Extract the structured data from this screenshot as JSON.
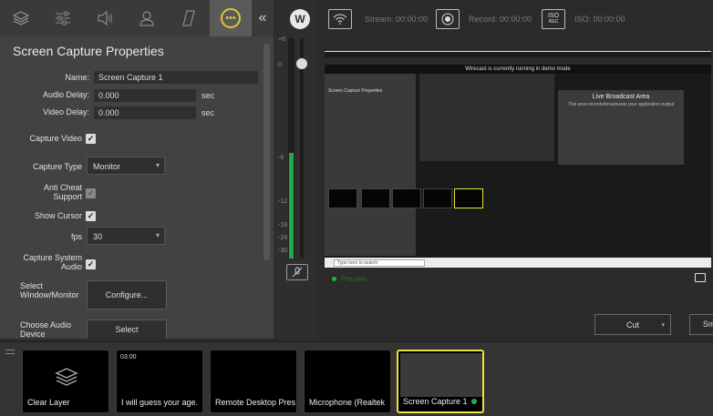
{
  "left_tabs": [
    {
      "name": "layers",
      "icon": "layers-icon"
    },
    {
      "name": "properties",
      "icon": "sliders-icon"
    },
    {
      "name": "audio",
      "icon": "speaker-icon"
    },
    {
      "name": "user",
      "icon": "user-icon"
    },
    {
      "name": "edit",
      "icon": "slash-icon"
    },
    {
      "name": "more",
      "icon": "ellipsis-icon",
      "active": true
    }
  ],
  "collapse_glyph": "«",
  "props": {
    "title": "Screen Capture Properties",
    "name_label": "Name:",
    "name_value": "Screen Capture 1",
    "audio_delay_label": "Audio Delay:",
    "audio_delay_value": "0.000",
    "audio_delay_unit": "sec",
    "video_delay_label": "Video Delay:",
    "video_delay_value": "0.000",
    "video_delay_unit": "sec",
    "capture_video_label": "Capture Video",
    "capture_type_label": "Capture Type",
    "capture_type_value": "Monitor",
    "anti_cheat_label_1": "Anti Cheat",
    "anti_cheat_label_2": "Support",
    "show_cursor_label": "Show Cursor",
    "fps_label": "fps",
    "fps_value": "30",
    "capture_system_audio_label_1": "Capture System",
    "capture_system_audio_label_2": "Audio",
    "select_window_label_1": "Select",
    "select_window_label_2": "Window/Monitor",
    "configure_button": "Configure...",
    "choose_audio_label_1": "Choose Audio",
    "choose_audio_label_2": "Device",
    "select_button": "Select",
    "check_glyph": "✓"
  },
  "meter": {
    "scale": [
      "+6",
      "0",
      "-6",
      "-12",
      "-18",
      "-24",
      "-30"
    ],
    "level_fraction": 0.48
  },
  "header": {
    "logo": "W",
    "stream_label": "Stream: 00:00:00",
    "record_label": "Record: 00:00:00",
    "iso_label": "ISO: 00:00:00",
    "iso_badge": "ISO",
    "iso_sub": "REC"
  },
  "preview": {
    "demo_banner": "Wirecast is currently running in demo mode",
    "inner_title": "Screen Capture Properties",
    "live_title": "Live Broadcast Area",
    "live_subtitle": "This area records/broadcasts your application output",
    "search_placeholder": "Type here to search",
    "label": "Preview"
  },
  "transition": {
    "cut_label": "Cut",
    "smooth_label": "Sm"
  },
  "shots": [
    {
      "label": "Clear Layer",
      "time": "",
      "selected": false
    },
    {
      "label": "I will guess your age.",
      "time": "03:00",
      "selected": false
    },
    {
      "label": "Remote Desktop Pres",
      "time": "",
      "selected": false
    },
    {
      "label": "Microphone (Realtek",
      "time": "",
      "selected": false
    },
    {
      "label": "Screen Capture 1",
      "time": "",
      "selected": true
    }
  ],
  "colors": {
    "accent_yellow": "#e6e637",
    "live_green": "#1db34c",
    "panel_bg": "#424242"
  }
}
